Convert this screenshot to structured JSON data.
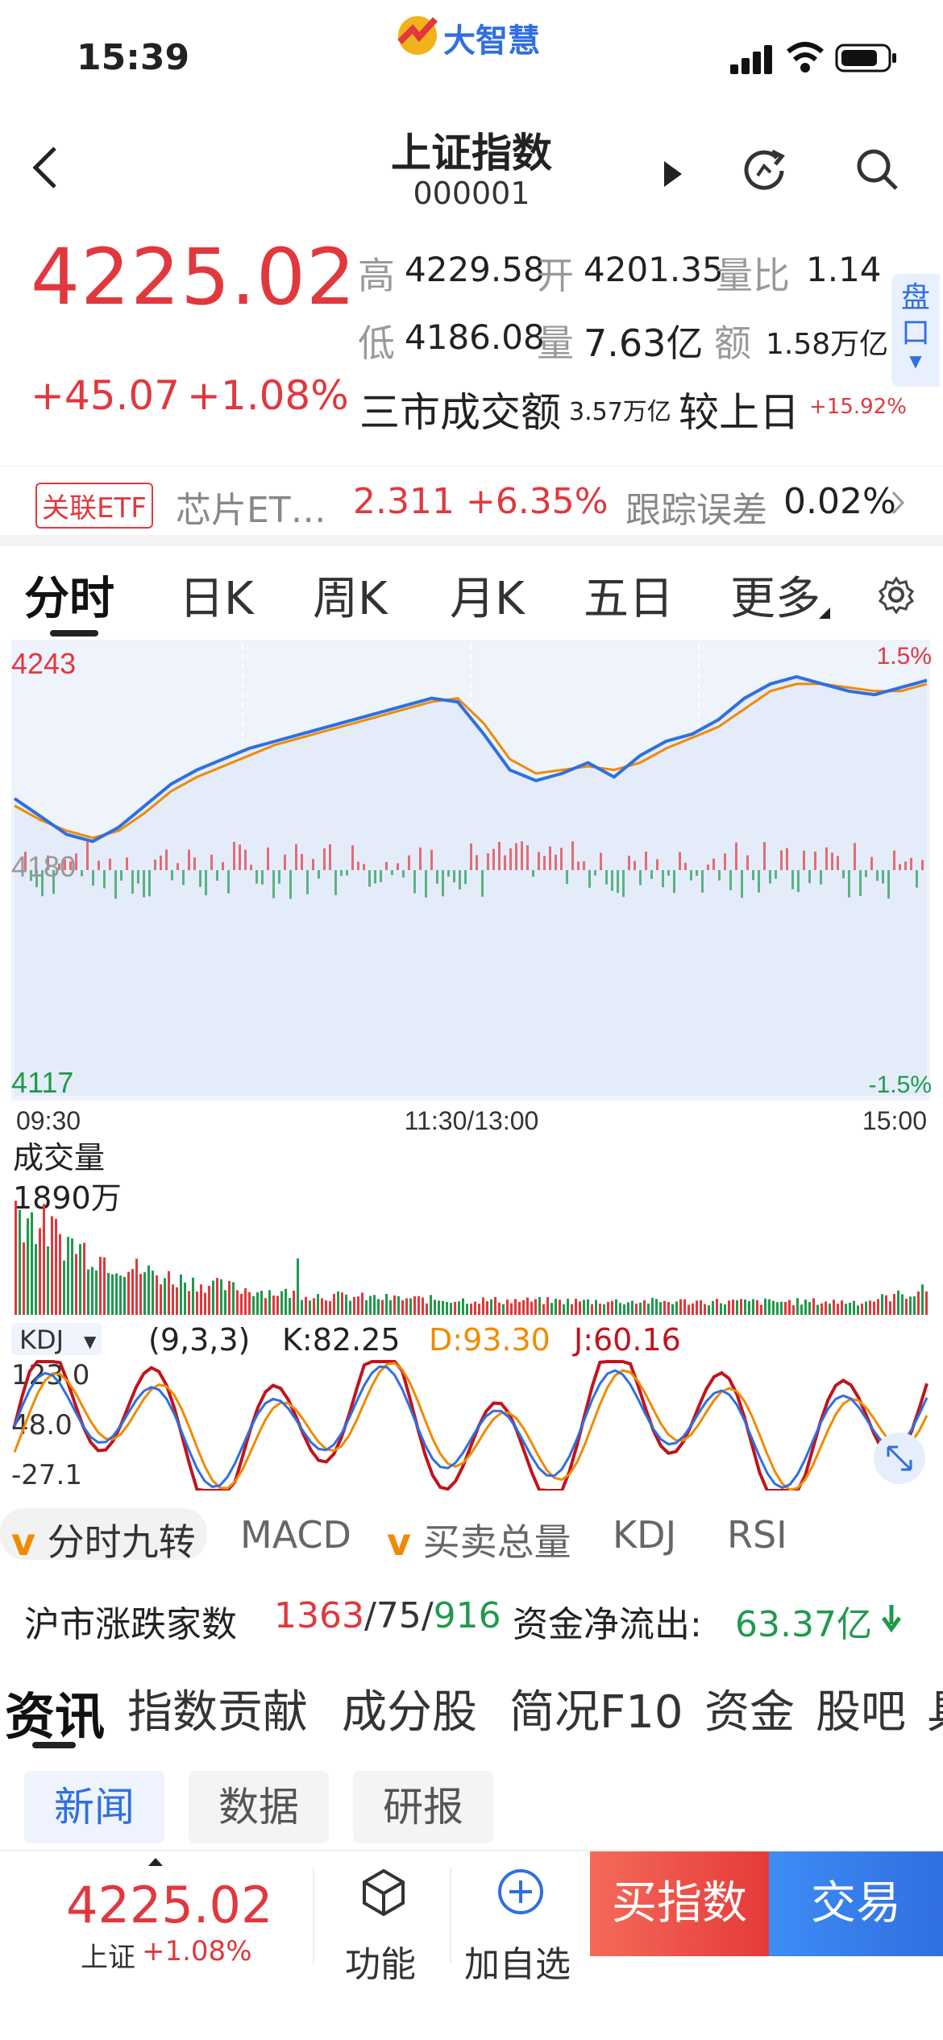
{
  "status": {
    "time": "15:39",
    "brand": "大智慧"
  },
  "header": {
    "title": "上证指数",
    "code": "000001"
  },
  "quote": {
    "price": "4225.02",
    "change": "+45.07",
    "change_pct": "+1.08%",
    "high_label": "高",
    "high": "4229.58",
    "open_label": "开",
    "open": "4201.35",
    "ratio_label": "量比",
    "ratio": "1.14",
    "low_label": "低",
    "low": "4186.08",
    "vol_label": "量",
    "vol": "7.63亿",
    "amt_label": "额",
    "amt": "1.58万亿",
    "market_label": "三市成交额",
    "market_amt": "3.57万亿",
    "vs_label": "较上日",
    "vs_val": "+15.92%",
    "pankou": "盘口"
  },
  "etf": {
    "tag": "关联ETF",
    "name": "芯片ET…",
    "value": "2.311 +6.35%",
    "err_label": "跟踪误差",
    "err": "0.02%"
  },
  "tabs": [
    "分时",
    "日K",
    "周K",
    "月K",
    "五日",
    "更多"
  ],
  "chart_labels": {
    "y_top": "4243",
    "y_mid": "4180",
    "y_bot": "4117",
    "pct_top": "1.5%",
    "pct_bot": "-1.5%",
    "t_start": "09:30",
    "t_mid": "11:30/13:00",
    "t_end": "15:00",
    "vol_title": "成交量",
    "vol_max": "1890万",
    "kdj_name": "KDJ",
    "kdj_params": "(9,3,3)",
    "kdj_k": "K:82.25",
    "kdj_d": "D:93.30",
    "kdj_j": "J:60.16",
    "kdj_t1": "123.0",
    "kdj_t2": "48.0",
    "kdj_t3": "-27.1"
  },
  "indicator_tabs": {
    "fs9": "分时九转",
    "macd": "MACD",
    "mmzl": "买卖总量",
    "kdj": "KDJ",
    "rsi": "RSI"
  },
  "breadth": {
    "label": "沪市涨跌家数",
    "up": "1363",
    "flat": "75",
    "down": "916"
  },
  "flow": {
    "label": "资金净流出:",
    "value": "63.37亿"
  },
  "news_tabs": [
    "资讯",
    "指数贡献",
    "成分股",
    "简况F10",
    "资金",
    "股吧",
    "具"
  ],
  "sub_tabs": [
    "新闻",
    "数据",
    "研报"
  ],
  "bottom": {
    "price": "4225.02",
    "name": "上证",
    "pct": "+1.08%",
    "func": "功能",
    "add": "加自选",
    "buy": "买指数",
    "trade": "交易"
  },
  "chart_data": {
    "type": "line",
    "xlabel": "",
    "ylabel": "",
    "x_ticks": [
      "09:30",
      "11:30/13:00",
      "15:00"
    ],
    "ylim": [
      4117,
      4243
    ],
    "series": [
      {
        "values": [
          4200,
          4195,
          4190,
          4188,
          4192,
          4198,
          4204,
          4208,
          4211,
          4214,
          4216,
          4218,
          4220,
          4222,
          4224,
          4226,
          4228,
          4227,
          4218,
          4208,
          4205,
          4207,
          4210,
          4206,
          4212,
          4216,
          4218,
          4222,
          4228,
          4232,
          4234,
          4232,
          4230,
          4229,
          4231,
          4233
        ]
      },
      {
        "values": [
          4198,
          4194,
          4191,
          4189,
          4191,
          4196,
          4202,
          4206,
          4209,
          4212,
          4215,
          4217,
          4219,
          4221,
          4223,
          4225,
          4227,
          4228,
          4221,
          4211,
          4207,
          4208,
          4209,
          4208,
          4210,
          4214,
          4217,
          4220,
          4225,
          4230,
          4232,
          4232,
          4231,
          4230,
          4230,
          4232
        ]
      }
    ],
    "colors": {
      "up": "#e0383d",
      "down": "#1f9a4d",
      "line1": "#2f6fe0",
      "line2": "#f08a00",
      "j": "#c0141d"
    }
  }
}
